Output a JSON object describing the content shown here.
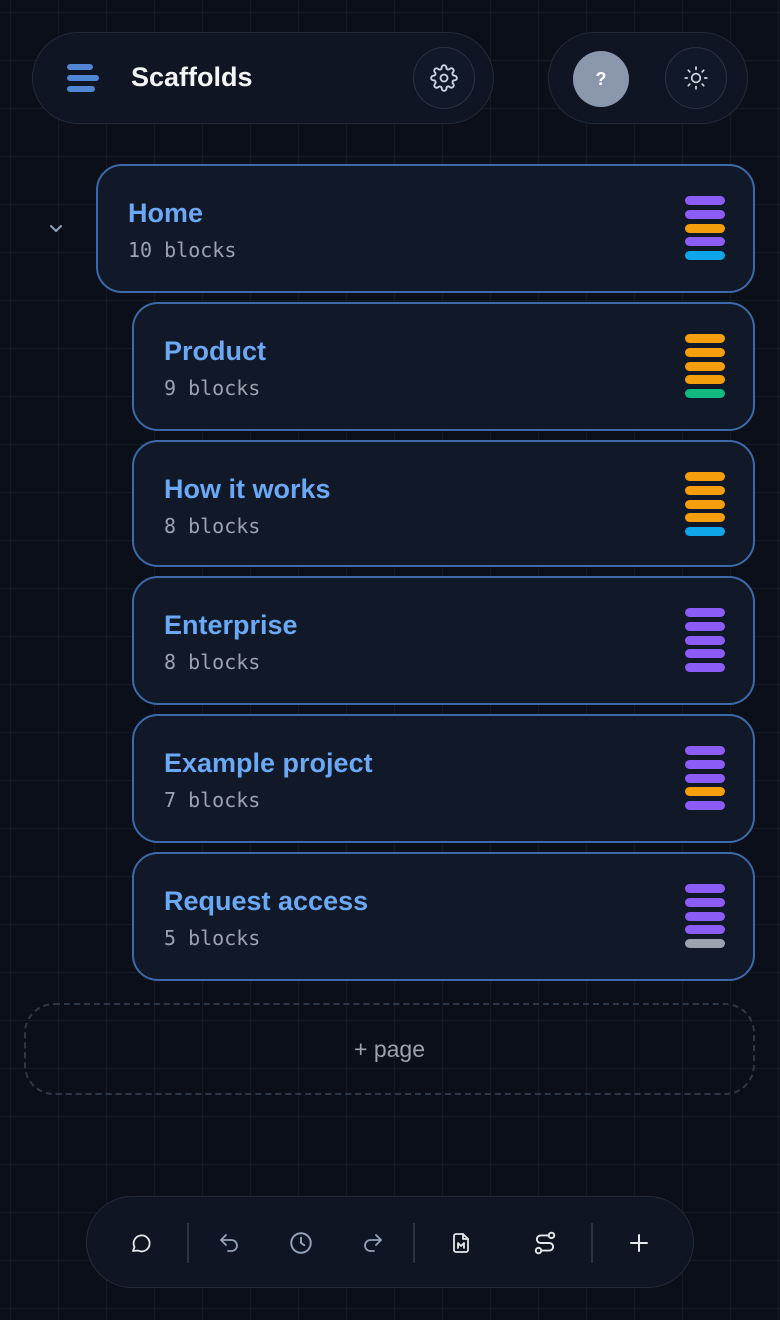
{
  "app": {
    "title": "Scaffolds"
  },
  "header": {
    "help_label": "?"
  },
  "pages": [
    {
      "name": "Home",
      "count": "10 blocks",
      "blocks": [
        "#8b5cf6",
        "#8b5cf6",
        "#f59e0b",
        "#8b5cf6",
        "#0ea5e9"
      ]
    },
    {
      "name": "Product",
      "count": "9 blocks",
      "blocks": [
        "#f59e0b",
        "#f59e0b",
        "#f59e0b",
        "#f59e0b",
        "#10b981"
      ]
    },
    {
      "name": "How it works",
      "count": "8 blocks",
      "blocks": [
        "#f59e0b",
        "#f59e0b",
        "#f59e0b",
        "#f59e0b",
        "#0ea5e9"
      ]
    },
    {
      "name": "Enterprise",
      "count": "8 blocks",
      "blocks": [
        "#8b5cf6",
        "#8b5cf6",
        "#8b5cf6",
        "#8b5cf6",
        "#8b5cf6"
      ]
    },
    {
      "name": "Example project",
      "count": "7 blocks",
      "blocks": [
        "#8b5cf6",
        "#8b5cf6",
        "#8b5cf6",
        "#f59e0b",
        "#8b5cf6"
      ]
    },
    {
      "name": "Request access",
      "count": "5 blocks",
      "blocks": [
        "#8b5cf6",
        "#8b5cf6",
        "#8b5cf6",
        "#8b5cf6",
        "#9ca3af"
      ]
    }
  ],
  "add_page_label": "+ page",
  "toolbar": {
    "icons": [
      "comment-icon",
      "undo-icon",
      "history-icon",
      "redo-icon",
      "markdown-file-icon",
      "route-icon",
      "plus-icon"
    ]
  },
  "colors": {
    "accent": "#6ba8f5",
    "card_border": "#3c6aa8",
    "background": "#0b0f19"
  }
}
